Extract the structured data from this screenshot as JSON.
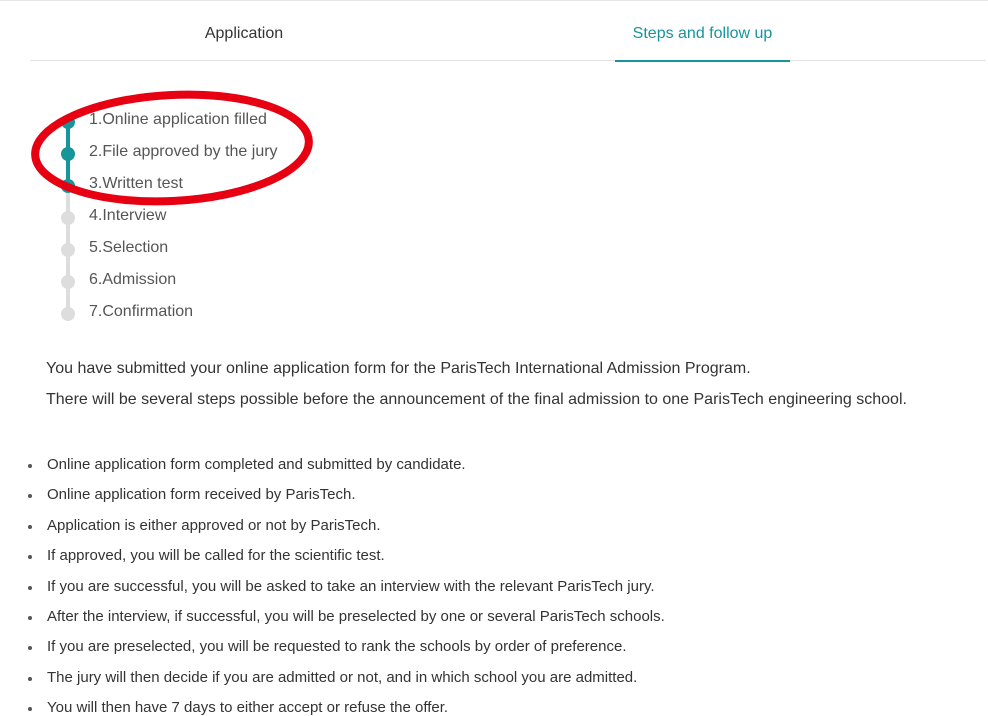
{
  "tabs": [
    {
      "label": "Application"
    },
    {
      "label": "Steps and follow up"
    }
  ],
  "active_tab": "Steps and follow up",
  "accent_color": "#16959b",
  "annotation_color": "#e60012",
  "steps": [
    {
      "label": "1.Online application filled",
      "completed": true
    },
    {
      "label": "2.File approved by the jury",
      "completed": true
    },
    {
      "label": "3.Written test",
      "completed": true
    },
    {
      "label": "4.Interview",
      "completed": false
    },
    {
      "label": "5.Selection",
      "completed": false
    },
    {
      "label": "6.Admission",
      "completed": false
    },
    {
      "label": "7.Confirmation",
      "completed": false
    }
  ],
  "intro": [
    "You have submitted your online application form for the ParisTech International Admission Program.",
    "There will be several steps possible before the announcement of the final admission to one ParisTech engineering school."
  ],
  "process": [
    "Online application form completed and submitted by candidate.",
    "Online application form received by ParisTech.",
    "Application is either approved or not by ParisTech.",
    "If approved, you will be called for the scientific test.",
    "If you are successful, you will be asked to take an interview with the relevant ParisTech jury.",
    "After the interview, if successful, you will be preselected by one or several ParisTech schools.",
    "If you are preselected, you will be requested to rank the schools by order of preference.",
    "The jury will then decide if you are admitted or not, and in which school you are admitted.",
    "You will then have 7 days to either accept or refuse the offer."
  ]
}
